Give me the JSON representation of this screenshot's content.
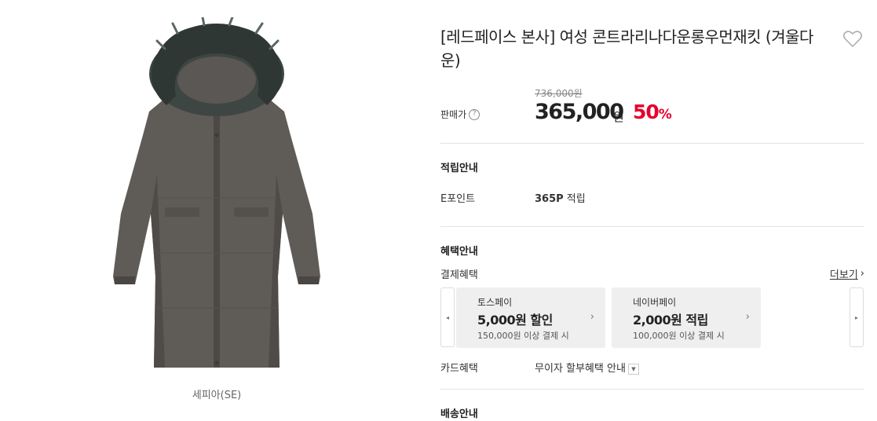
{
  "gallery": {
    "color_caption": "세피아(SE)"
  },
  "product": {
    "title": "[레드페이스 본사] 여성 콘트라리나다운롱우먼재킷 (겨울다운)",
    "wishlist_icon": "heart-outline-icon"
  },
  "pricing": {
    "label": "판매가",
    "help_glyph": "?",
    "original_price": "736,000원",
    "sale_price": "365,000",
    "currency": "원",
    "discount_value": "50",
    "discount_unit": "%",
    "discount_color": "#e6002c"
  },
  "points": {
    "section_title": "적립안내",
    "label": "E포인트",
    "amount": "365P",
    "suffix": " 적립"
  },
  "benefits": {
    "section_title": "혜택안내",
    "payment_label": "결제혜택",
    "more_label": "더보기",
    "more_glyph": "›",
    "prev_glyph": "◂",
    "next_glyph": "▸",
    "cards": [
      {
        "name": "토스페이",
        "amount": "5,000원 할인",
        "condition": "150,000원 이상 결제 시",
        "chevron": "›"
      },
      {
        "name": "네이버페이",
        "amount": "2,000원 적립",
        "condition": "100,000원 이상 결제 시",
        "chevron": "›"
      }
    ],
    "card_label": "카드혜택",
    "card_value": "무이자 할부혜택 안내",
    "card_dropdown_glyph": "▼"
  },
  "delivery": {
    "section_title": "배송안내"
  }
}
